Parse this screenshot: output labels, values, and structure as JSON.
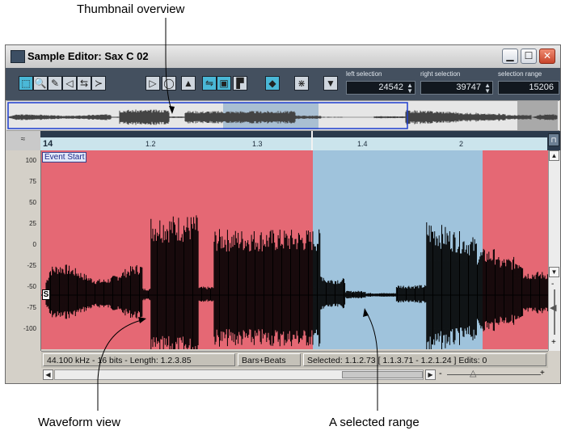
{
  "callouts": {
    "top": "Thumbnail overview",
    "bottom_left": "Waveform view",
    "bottom_right": "A selected range"
  },
  "window": {
    "title": "Sample Editor: Sax C 02",
    "icon": "sample-editor-icon"
  },
  "toolbar": {
    "tools": [
      {
        "name": "range-selection-tool",
        "glyph": "⬚",
        "active": true
      },
      {
        "name": "zoom-tool",
        "glyph": "🔍",
        "active": false
      },
      {
        "name": "draw-tool",
        "glyph": "✎",
        "active": false
      },
      {
        "name": "play-tool",
        "glyph": "◁",
        "active": false
      },
      {
        "name": "scrub-tool",
        "glyph": "⇆",
        "active": false
      },
      {
        "name": "snap-tool",
        "glyph": "≻",
        "active": false
      },
      {
        "name": "play-button",
        "glyph": "▷",
        "active": false
      },
      {
        "name": "loop-button",
        "glyph": "◯",
        "active": false
      },
      {
        "name": "volume-slider",
        "glyph": "▲",
        "active": false
      },
      {
        "name": "show-event-button",
        "glyph": "⇋",
        "active": true
      },
      {
        "name": "autoscroll-button",
        "glyph": "▣",
        "active": true
      },
      {
        "name": "snap-to-zero-button",
        "glyph": "▛",
        "active": false
      },
      {
        "name": "follow-button",
        "glyph": "◆",
        "active": true
      },
      {
        "name": "hitpoint-button",
        "glyph": "⋇",
        "active": false
      },
      {
        "name": "info-button",
        "glyph": "▼",
        "active": false
      }
    ],
    "left_selection": {
      "label": "left selection",
      "value": "24542"
    },
    "right_selection": {
      "label": "right selection",
      "value": "39747"
    },
    "selection_range": {
      "label": "selection range",
      "value": "15206"
    }
  },
  "ruler": {
    "corner": "≈",
    "marks": [
      "14",
      "1.2",
      "1.3",
      "1.4",
      "2"
    ],
    "button": "⊓"
  },
  "event_start_label": "Event Start",
  "s_marker": "S",
  "amplitude_labels": [
    "100",
    "75",
    "50",
    "25",
    "0",
    "-25",
    "-50",
    "-75",
    "-100"
  ],
  "status": {
    "format": "44.100 kHz - 16 bits - Length:   1.2.3.85",
    "display_mode": "Bars+Beats",
    "selected": "Selected:   1.1.2.73 [   1.1.3.71 -   1.2.1.24 ]  Edits: 0"
  },
  "colors": {
    "event_region": "#e56874",
    "selected_range": "#9fc3dc",
    "waveform": "#000000",
    "toolbar": "#44505f",
    "thumbnail_frame": "#1f3fcf"
  }
}
